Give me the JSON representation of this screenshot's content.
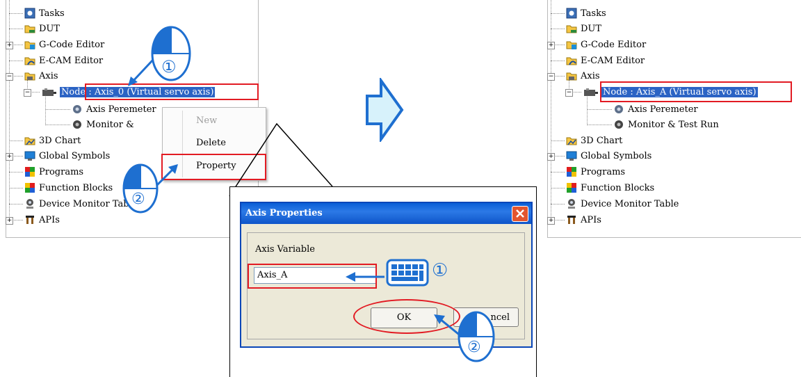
{
  "tree": {
    "items": [
      {
        "key": "tasks",
        "label": "Tasks"
      },
      {
        "key": "dut",
        "label": "DUT"
      },
      {
        "key": "gcode",
        "label": "G-Code Editor"
      },
      {
        "key": "ecam",
        "label": "E-CAM Editor"
      },
      {
        "key": "axis",
        "label": "Axis"
      },
      {
        "key": "axis_param",
        "label": "Axis Peremeter"
      },
      {
        "key": "monitor",
        "label": "Monitor & Test Run"
      },
      {
        "key": "chart3d",
        "label": "3D Chart"
      },
      {
        "key": "global",
        "label": "Global Symbols"
      },
      {
        "key": "programs",
        "label": "Programs"
      },
      {
        "key": "fblocks",
        "label": "Function Blocks"
      },
      {
        "key": "devmon",
        "label": "Device Monitor Table"
      },
      {
        "key": "apis",
        "label": "APIs"
      }
    ],
    "node_before": "Node : Axis_0 (Virtual servo axis)",
    "node_after": "Node : Axis_A (Virtual servo axis)",
    "axis_param_truncated": "Axis Peremeter",
    "monitor_truncated": "Monitor &",
    "devmon_truncated": "Device Monitor Table"
  },
  "context_menu": {
    "new": "New",
    "delete": "Delete",
    "property": "Property"
  },
  "dialog": {
    "title": "Axis Properties",
    "field_label": "Axis Variable",
    "field_value": "Axis_A",
    "ok": "OK",
    "cancel": "Cancel",
    "cancel_visible": "ncel"
  },
  "steps": {
    "one": "①",
    "two": "②"
  },
  "colors": {
    "highlight": "#e21b23",
    "arrow": "#1e6fd0",
    "selection": "#2b63c4"
  }
}
